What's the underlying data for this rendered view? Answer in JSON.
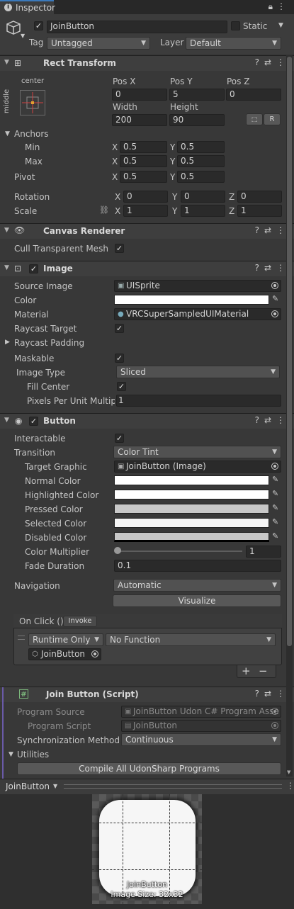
{
  "tab": {
    "title": "Inspector"
  },
  "gameobject": {
    "name": "JoinButton",
    "static_label": "Static",
    "tag_label": "Tag",
    "tag_value": "Untagged",
    "layer_label": "Layer",
    "layer_value": "Default"
  },
  "rect_transform": {
    "title": "Rect Transform",
    "anchor_preset_top": "center",
    "anchor_preset_side": "middle",
    "pos_x_label": "Pos X",
    "pos_y_label": "Pos Y",
    "pos_z_label": "Pos Z",
    "pos_x": "0",
    "pos_y": "5",
    "pos_z": "0",
    "width_label": "Width",
    "height_label": "Height",
    "width": "200",
    "height": "90",
    "raw_button": "R",
    "anchors_label": "Anchors",
    "min_label": "Min",
    "max_label": "Max",
    "min_x": "0.5",
    "min_y": "0.5",
    "max_x": "0.5",
    "max_y": "0.5",
    "pivot_label": "Pivot",
    "pivot_x": "0.5",
    "pivot_y": "0.5",
    "rotation_label": "Rotation",
    "rot_x": "0",
    "rot_y": "0",
    "rot_z": "0",
    "scale_label": "Scale",
    "scale_x": "1",
    "scale_y": "1",
    "scale_z": "1",
    "x": "X",
    "y": "Y",
    "z": "Z"
  },
  "canvas_renderer": {
    "title": "Canvas Renderer",
    "cull_label": "Cull Transparent Mesh"
  },
  "image": {
    "title": "Image",
    "source_label": "Source Image",
    "source_value": "UISprite",
    "color_label": "Color",
    "material_label": "Material",
    "material_value": "VRCSuperSampledUIMaterial",
    "raycast_label": "Raycast Target",
    "raycast_padding_label": "Raycast Padding",
    "maskable_label": "Maskable",
    "type_label": "Image Type",
    "type_value": "Sliced",
    "fill_label": "Fill Center",
    "ppu_label": "Pixels Per Unit Multipli",
    "ppu_value": "1"
  },
  "button": {
    "title": "Button",
    "interactable_label": "Interactable",
    "transition_label": "Transition",
    "transition_value": "Color Tint",
    "target_label": "Target Graphic",
    "target_value": "JoinButton (Image)",
    "normal_label": "Normal Color",
    "highlighted_label": "Highlighted Color",
    "pressed_label": "Pressed Color",
    "selected_label": "Selected Color",
    "disabled_label": "Disabled Color",
    "multiplier_label": "Color Multiplier",
    "multiplier_value": "1",
    "fade_label": "Fade Duration",
    "fade_value": "0.1",
    "navigation_label": "Navigation",
    "navigation_value": "Automatic",
    "visualize_label": "Visualize",
    "onclick_label": "On Click ()",
    "invoke_label": "Invoke",
    "runtime_value": "Runtime Only",
    "function_value": "No Function",
    "object_value": "JoinButton",
    "plus": "+",
    "minus": "−"
  },
  "script": {
    "title": "Join Button (Script)",
    "program_source_label": "Program Source",
    "program_source_value": "JoinButton Udon C# Program Asse",
    "program_script_label": "Program Script",
    "program_script_value": "JoinButton",
    "sync_label": "Synchronization Method",
    "sync_value": "Continuous",
    "utilities_label": "Utilities",
    "compile_label": "Compile All UdonSharp Programs"
  },
  "preview": {
    "title": "JoinButton",
    "name": "JoinButton",
    "size": "Image Size: 32x32"
  },
  "colors": {
    "normal": "#ffffff",
    "highlighted": "#ffffff",
    "pressed": "#c8c8c8",
    "selected": "#f5f5f5",
    "disabled": "#c8c8c8",
    "accent": "#3a79bb"
  }
}
